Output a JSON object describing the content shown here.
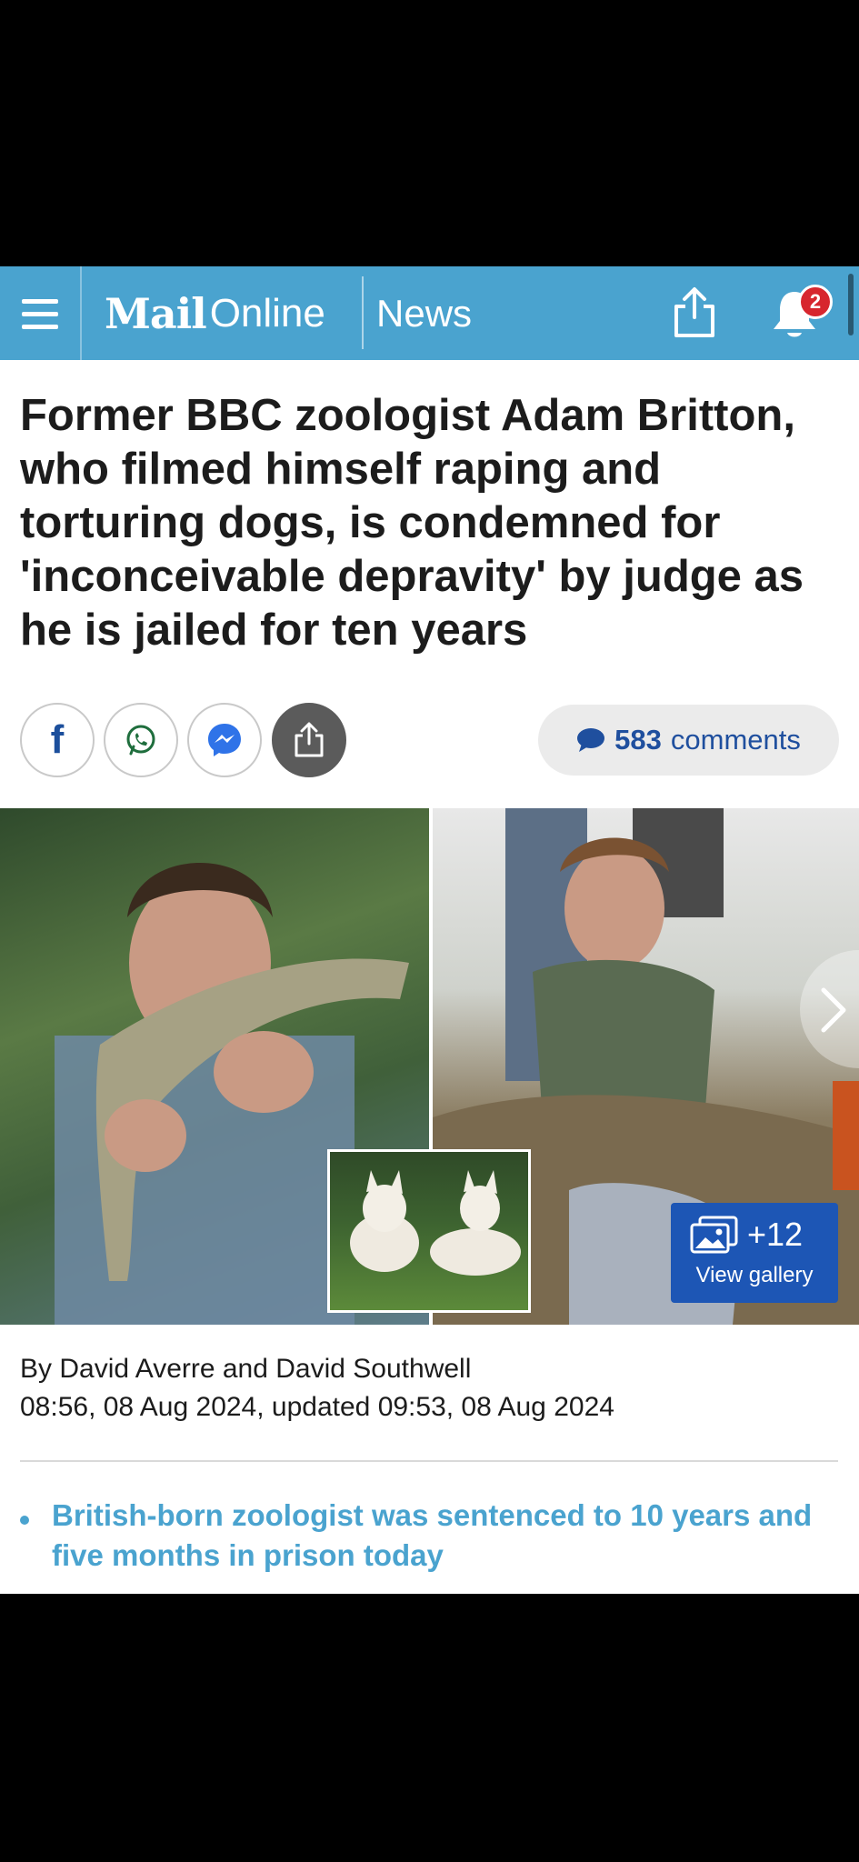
{
  "header": {
    "brand_primary": "Mail",
    "brand_secondary": "Online",
    "section": "News",
    "notification_count": "2",
    "accent_color": "#4aa3cf"
  },
  "article": {
    "headline": "Former BBC zoologist Adam Britton, who filmed himself raping and torturing dogs, is condemned for 'inconceivable depravity' by judge as he is jailed for ten years",
    "comments_count": "583",
    "comments_label": "comments",
    "gallery_count": "+12",
    "gallery_label": "View gallery",
    "byline": "By David Averre and David Southwell",
    "dateline": "08:56, 08 Aug 2024, updated 09:53, 08 Aug 2024",
    "bullets": [
      "British-born zoologist was sentenced to 10 years and five months in prison today"
    ]
  },
  "icons": [
    "menu-icon",
    "share-icon",
    "bell-icon",
    "facebook-icon",
    "whatsapp-icon",
    "messenger-icon",
    "comment-bubble-icon",
    "gallery-icon",
    "chevron-right-icon"
  ]
}
